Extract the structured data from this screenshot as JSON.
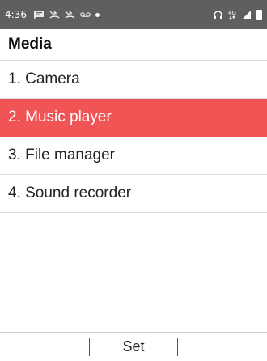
{
  "status_bar": {
    "time": "4:36",
    "left_icons": [
      "message-icon",
      "missed-call-icon",
      "missed-call-icon",
      "voicemail-icon",
      "notification-dot-icon"
    ],
    "right_icons": [
      "headset-icon",
      "data-4g-icon",
      "signal-icon",
      "battery-icon"
    ],
    "data_label": "4G"
  },
  "header": {
    "title": "Media"
  },
  "menu": {
    "items": [
      {
        "label": "1. Camera",
        "selected": false
      },
      {
        "label": "2. Music player",
        "selected": true
      },
      {
        "label": "3. File manager",
        "selected": false
      },
      {
        "label": "4. Sound recorder",
        "selected": false
      }
    ]
  },
  "softkeys": {
    "left": "",
    "center": "Set",
    "right": ""
  },
  "colors": {
    "status_bar_bg": "#5f5f5f",
    "selected_bg": "#f05454",
    "divider": "#d9d9d9"
  }
}
